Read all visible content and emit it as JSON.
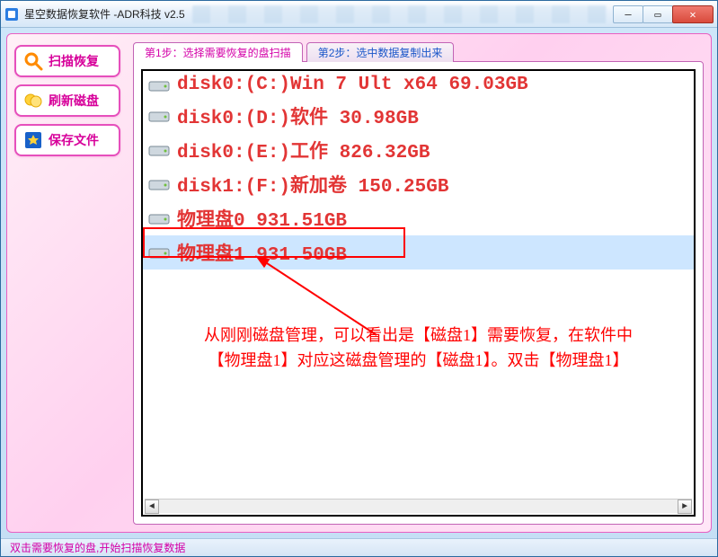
{
  "window": {
    "title": "星空数据恢复软件   -ADR科技 v2.5"
  },
  "sidebar": {
    "items": [
      {
        "label": "扫描恢复"
      },
      {
        "label": "刷新磁盘"
      },
      {
        "label": "保存文件"
      }
    ]
  },
  "tabs": [
    {
      "label": "第1步：选择需要恢复的盘扫描",
      "active": true
    },
    {
      "label": "第2步：选中数据复制出来",
      "active": false
    }
  ],
  "disks": [
    {
      "text": "disk0:(C:)Win 7 Ult x64 69.03GB",
      "selected": false
    },
    {
      "text": "disk0:(D:)软件 30.98GB",
      "selected": false
    },
    {
      "text": "disk0:(E:)工作 826.32GB",
      "selected": false
    },
    {
      "text": "disk1:(F:)新加卷 150.25GB",
      "selected": false
    },
    {
      "text": "物理盘0 931.51GB",
      "selected": false
    },
    {
      "text": "物理盘1 931.50GB",
      "selected": true
    }
  ],
  "annotation": {
    "line1": "从刚刚磁盘管理，可以看出是【磁盘1】需要恢复，在软件中",
    "line2": "【物理盘1】对应这磁盘管理的【磁盘1】。双击【物理盘1】"
  },
  "status": "双击需要恢复的盘,开始扫描恢复数据",
  "colors": {
    "accent_pink": "#e64fbc",
    "text_red": "#e23535",
    "annotation_red": "#ff0000",
    "link_blue": "#1a56c9"
  }
}
